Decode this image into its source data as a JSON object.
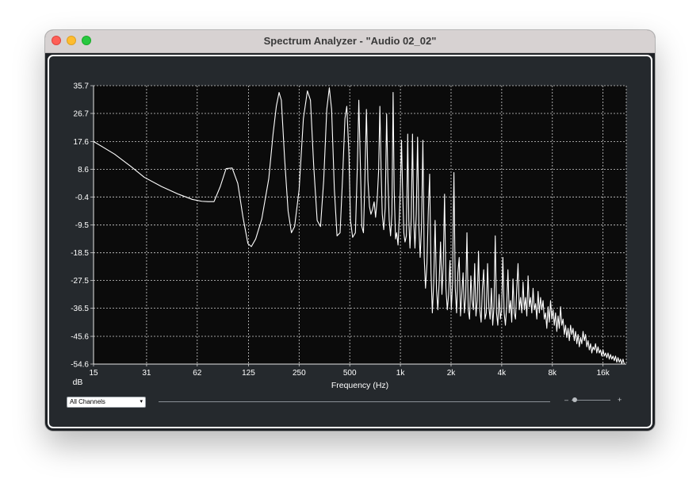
{
  "window": {
    "title": "Spectrum Analyzer - \"Audio 02_02\""
  },
  "controls": {
    "channel_select_value": "All Channels",
    "channel_select_arrow": "▾",
    "zoom_minus": "–",
    "zoom_plus": "+"
  },
  "colors": {
    "plot_background": "#0b0b0b",
    "grid": "#cfcfcf",
    "trace": "#ffffff",
    "panel": "#25292d"
  },
  "chart_data": {
    "type": "line",
    "title": "",
    "xlabel": "Frequency (Hz)",
    "ylabel": "dB",
    "x_scale": "log",
    "xlim": [
      15,
      22000
    ],
    "ylim": [
      -54.6,
      35.7
    ],
    "x_tick_labels": [
      "15",
      "31",
      "62",
      "125",
      "250",
      "500",
      "1k",
      "2k",
      "4k",
      "8k",
      "16k"
    ],
    "x_ticks": [
      15,
      31,
      62,
      125,
      250,
      500,
      1000,
      2000,
      4000,
      8000,
      16000
    ],
    "y_ticks": [
      35.7,
      26.7,
      17.6,
      8.6,
      -0.4,
      -9.5,
      -18.5,
      -27.5,
      -36.5,
      -45.6,
      -54.6
    ],
    "y_tick_labels": [
      "35.7",
      "26.7",
      "17.6",
      "8.6",
      "-0.4",
      "-9.5",
      "-18.5",
      "-27.5",
      "-36.5",
      "-45.6",
      "-54.6"
    ],
    "grid": true,
    "series": [
      {
        "values": [
          [
            15,
            17.6
          ],
          [
            20,
            13.5
          ],
          [
            25,
            9.5
          ],
          [
            30,
            6.0
          ],
          [
            38,
            3.0
          ],
          [
            48,
            0.5
          ],
          [
            58,
            -1.2
          ],
          [
            66,
            -1.8
          ],
          [
            72,
            -1.9
          ],
          [
            78,
            -1.9
          ],
          [
            85,
            3.0
          ],
          [
            92,
            8.8
          ],
          [
            100,
            9.0
          ],
          [
            108,
            4.0
          ],
          [
            116,
            -7.0
          ],
          [
            124,
            -15.5
          ],
          [
            130,
            -16.5
          ],
          [
            138,
            -14.0
          ],
          [
            150,
            -7.5
          ],
          [
            165,
            5.5
          ],
          [
            175,
            20.0
          ],
          [
            183,
            29.0
          ],
          [
            190,
            33.5
          ],
          [
            196,
            31.0
          ],
          [
            205,
            12.0
          ],
          [
            215,
            -5.0
          ],
          [
            225,
            -12.0
          ],
          [
            235,
            -10.0
          ],
          [
            250,
            2.0
          ],
          [
            265,
            25.0
          ],
          [
            280,
            34.0
          ],
          [
            292,
            31.0
          ],
          [
            305,
            10.0
          ],
          [
            320,
            -8.0
          ],
          [
            335,
            -10.0
          ],
          [
            350,
            5.0
          ],
          [
            365,
            28.0
          ],
          [
            378,
            35.0
          ],
          [
            390,
            28.0
          ],
          [
            405,
            2.0
          ],
          [
            420,
            -13.0
          ],
          [
            438,
            -12.0
          ],
          [
            455,
            8.0
          ],
          [
            468,
            25.0
          ],
          [
            480,
            29.0
          ],
          [
            494,
            14.0
          ],
          [
            505,
            -8.0
          ],
          [
            520,
            -13.5
          ],
          [
            540,
            -12.0
          ],
          [
            555,
            10.0
          ],
          [
            566,
            31.0
          ],
          [
            578,
            10.0
          ],
          [
            590,
            -10.0
          ],
          [
            603,
            -12.0
          ],
          [
            615,
            5.0
          ],
          [
            628,
            28.0
          ],
          [
            641,
            5.0
          ],
          [
            655,
            -3.5
          ],
          [
            668,
            -6.0
          ],
          [
            682,
            -4.5
          ],
          [
            698,
            -2.0
          ],
          [
            712,
            -7.0
          ],
          [
            728,
            -1.0
          ],
          [
            742,
            8.0
          ],
          [
            755,
            29.0
          ],
          [
            768,
            8.0
          ],
          [
            780,
            -6.0
          ],
          [
            796,
            -11.0
          ],
          [
            812,
            -4.0
          ],
          [
            828,
            26.5
          ],
          [
            842,
            6.0
          ],
          [
            858,
            -8.0
          ],
          [
            874,
            -13.0
          ],
          [
            890,
            -6.0
          ],
          [
            905,
            33.5
          ],
          [
            918,
            2.0
          ],
          [
            935,
            -14.0
          ],
          [
            950,
            -12.0
          ],
          [
            968,
            -16.0
          ],
          [
            985,
            -7.0
          ],
          [
            1000,
            3.0
          ],
          [
            1015,
            18.0
          ],
          [
            1030,
            2.0
          ],
          [
            1048,
            -12.0
          ],
          [
            1065,
            -15.0
          ],
          [
            1085,
            -13.0
          ],
          [
            1105,
            20.0
          ],
          [
            1122,
            -8.0
          ],
          [
            1140,
            -17.0
          ],
          [
            1160,
            -7.0
          ],
          [
            1180,
            20.0
          ],
          [
            1200,
            -8.0
          ],
          [
            1220,
            -17.0
          ],
          [
            1242,
            -6.0
          ],
          [
            1265,
            19.0
          ],
          [
            1288,
            -10.0
          ],
          [
            1310,
            -20.0
          ],
          [
            1335,
            -10.0
          ],
          [
            1360,
            18.0
          ],
          [
            1385,
            -20.0
          ],
          [
            1410,
            -30.0
          ],
          [
            1438,
            -22.0
          ],
          [
            1465,
            -5.0
          ],
          [
            1492,
            7.0
          ],
          [
            1520,
            -25.0
          ],
          [
            1548,
            -38.0
          ],
          [
            1578,
            -28.0
          ],
          [
            1608,
            -8.0
          ],
          [
            1638,
            -30.0
          ],
          [
            1668,
            -37.0
          ],
          [
            1700,
            -28.0
          ],
          [
            1732,
            -15.0
          ],
          [
            1765,
            -32.0
          ],
          [
            1798,
            -22.0
          ],
          [
            1830,
            0.5
          ],
          [
            1865,
            -30.0
          ],
          [
            1900,
            -37.0
          ],
          [
            1935,
            -32.0
          ],
          [
            1970,
            -21.0
          ],
          [
            2006,
            -37.0
          ],
          [
            2042,
            -28.0
          ],
          [
            2080,
            7.5
          ],
          [
            2118,
            -30.0
          ],
          [
            2157,
            -38.0
          ],
          [
            2196,
            -25.0
          ],
          [
            2236,
            -20.0
          ],
          [
            2276,
            -39.0
          ],
          [
            2316,
            -32.0
          ],
          [
            2358,
            -25.0
          ],
          [
            2400,
            -38.0
          ],
          [
            2442,
            -33.0
          ],
          [
            2486,
            -12.0
          ],
          [
            2530,
            -37.0
          ],
          [
            2576,
            -40.0
          ],
          [
            2622,
            -26.0
          ],
          [
            2668,
            -34.0
          ],
          [
            2716,
            -37.0
          ],
          [
            2764,
            -22.0
          ],
          [
            2812,
            -39.0
          ],
          [
            2862,
            -34.0
          ],
          [
            2913,
            -18.0
          ],
          [
            2965,
            -37.0
          ],
          [
            3018,
            -41.0
          ],
          [
            3072,
            -30.0
          ],
          [
            3126,
            -24.0
          ],
          [
            3182,
            -40.0
          ],
          [
            3238,
            -38.0
          ],
          [
            3296,
            -22.0
          ],
          [
            3354,
            -36.0
          ],
          [
            3414,
            -40.0
          ],
          [
            3474,
            -30.0
          ],
          [
            3536,
            -42.0
          ],
          [
            3598,
            -36.0
          ],
          [
            3662,
            -13.0
          ],
          [
            3726,
            -38.0
          ],
          [
            3792,
            -42.0
          ],
          [
            3858,
            -32.0
          ],
          [
            3926,
            -40.0
          ],
          [
            3995,
            -37.0
          ],
          [
            4065,
            -20.0
          ],
          [
            4136,
            -38.0
          ],
          [
            4208,
            -42.0
          ],
          [
            4282,
            -36.0
          ],
          [
            4356,
            -24.0
          ],
          [
            4432,
            -38.0
          ],
          [
            4510,
            -34.0
          ],
          [
            4588,
            -41.0
          ],
          [
            4668,
            -27.0
          ],
          [
            4750,
            -38.0
          ],
          [
            4832,
            -40.0
          ],
          [
            4916,
            -30.0
          ],
          [
            5002,
            -22.0
          ],
          [
            5088,
            -37.0
          ],
          [
            5176,
            -33.0
          ],
          [
            5266,
            -38.0
          ],
          [
            5358,
            -28.0
          ],
          [
            5450,
            -37.0
          ],
          [
            5544,
            -33.0
          ],
          [
            5640,
            -39.0
          ],
          [
            5738,
            -26.0
          ],
          [
            5836,
            -36.0
          ],
          [
            5938,
            -33.0
          ],
          [
            6040,
            -38.0
          ],
          [
            6144,
            -30.0
          ],
          [
            6250,
            -37.0
          ],
          [
            6358,
            -35.0
          ],
          [
            6468,
            -40.0
          ],
          [
            6580,
            -31.0
          ],
          [
            6694,
            -38.0
          ],
          [
            6808,
            -33.0
          ],
          [
            6926,
            -37.0
          ],
          [
            7044,
            -34.0
          ],
          [
            7166,
            -40.0
          ],
          [
            7290,
            -38.0
          ],
          [
            7416,
            -43.0
          ],
          [
            7544,
            -36.0
          ],
          [
            7674,
            -41.0
          ],
          [
            7806,
            -34.0
          ],
          [
            7940,
            -40.0
          ],
          [
            8078,
            -37.0
          ],
          [
            8216,
            -42.0
          ],
          [
            8358,
            -38.0
          ],
          [
            8502,
            -44.0
          ],
          [
            8650,
            -39.0
          ],
          [
            8800,
            -43.0
          ],
          [
            8950,
            -36.0
          ],
          [
            9104,
            -42.0
          ],
          [
            9262,
            -40.0
          ],
          [
            9422,
            -45.0
          ],
          [
            9584,
            -42.0
          ],
          [
            9750,
            -46.0
          ],
          [
            9918,
            -43.0
          ],
          [
            10090,
            -47.0
          ],
          [
            10264,
            -42.0
          ],
          [
            10440,
            -45.0
          ],
          [
            10620,
            -43.0
          ],
          [
            10804,
            -47.0
          ],
          [
            10990,
            -44.0
          ],
          [
            11180,
            -48.0
          ],
          [
            11372,
            -45.0
          ],
          [
            11568,
            -49.0
          ],
          [
            11768,
            -46.0
          ],
          [
            11970,
            -48.0
          ],
          [
            12178,
            -44.0
          ],
          [
            12388,
            -47.0
          ],
          [
            12600,
            -45.0
          ],
          [
            12818,
            -49.0
          ],
          [
            13038,
            -47.0
          ],
          [
            13264,
            -50.0
          ],
          [
            13492,
            -48.0
          ],
          [
            13726,
            -51.0
          ],
          [
            13962,
            -49.0
          ],
          [
            14202,
            -50.0
          ],
          [
            14448,
            -48.0
          ],
          [
            14696,
            -51.0
          ],
          [
            14950,
            -49.0
          ],
          [
            15208,
            -51.0
          ],
          [
            15470,
            -50.0
          ],
          [
            15736,
            -52.0
          ],
          [
            16008,
            -50.0
          ],
          [
            16284,
            -52.0
          ],
          [
            16564,
            -51.0
          ],
          [
            16850,
            -52.5
          ],
          [
            17140,
            -51.0
          ],
          [
            17436,
            -53.0
          ],
          [
            17736,
            -51.5
          ],
          [
            18042,
            -53.0
          ],
          [
            18354,
            -52.0
          ],
          [
            18670,
            -53.5
          ],
          [
            18992,
            -52.0
          ],
          [
            19320,
            -54.0
          ],
          [
            19652,
            -52.5
          ],
          [
            19992,
            -54.0
          ],
          [
            20336,
            -53.0
          ],
          [
            20688,
            -54.5
          ],
          [
            21044,
            -53.0
          ],
          [
            21408,
            -54.6
          ],
          [
            22000,
            -56.0
          ]
        ]
      }
    ]
  }
}
